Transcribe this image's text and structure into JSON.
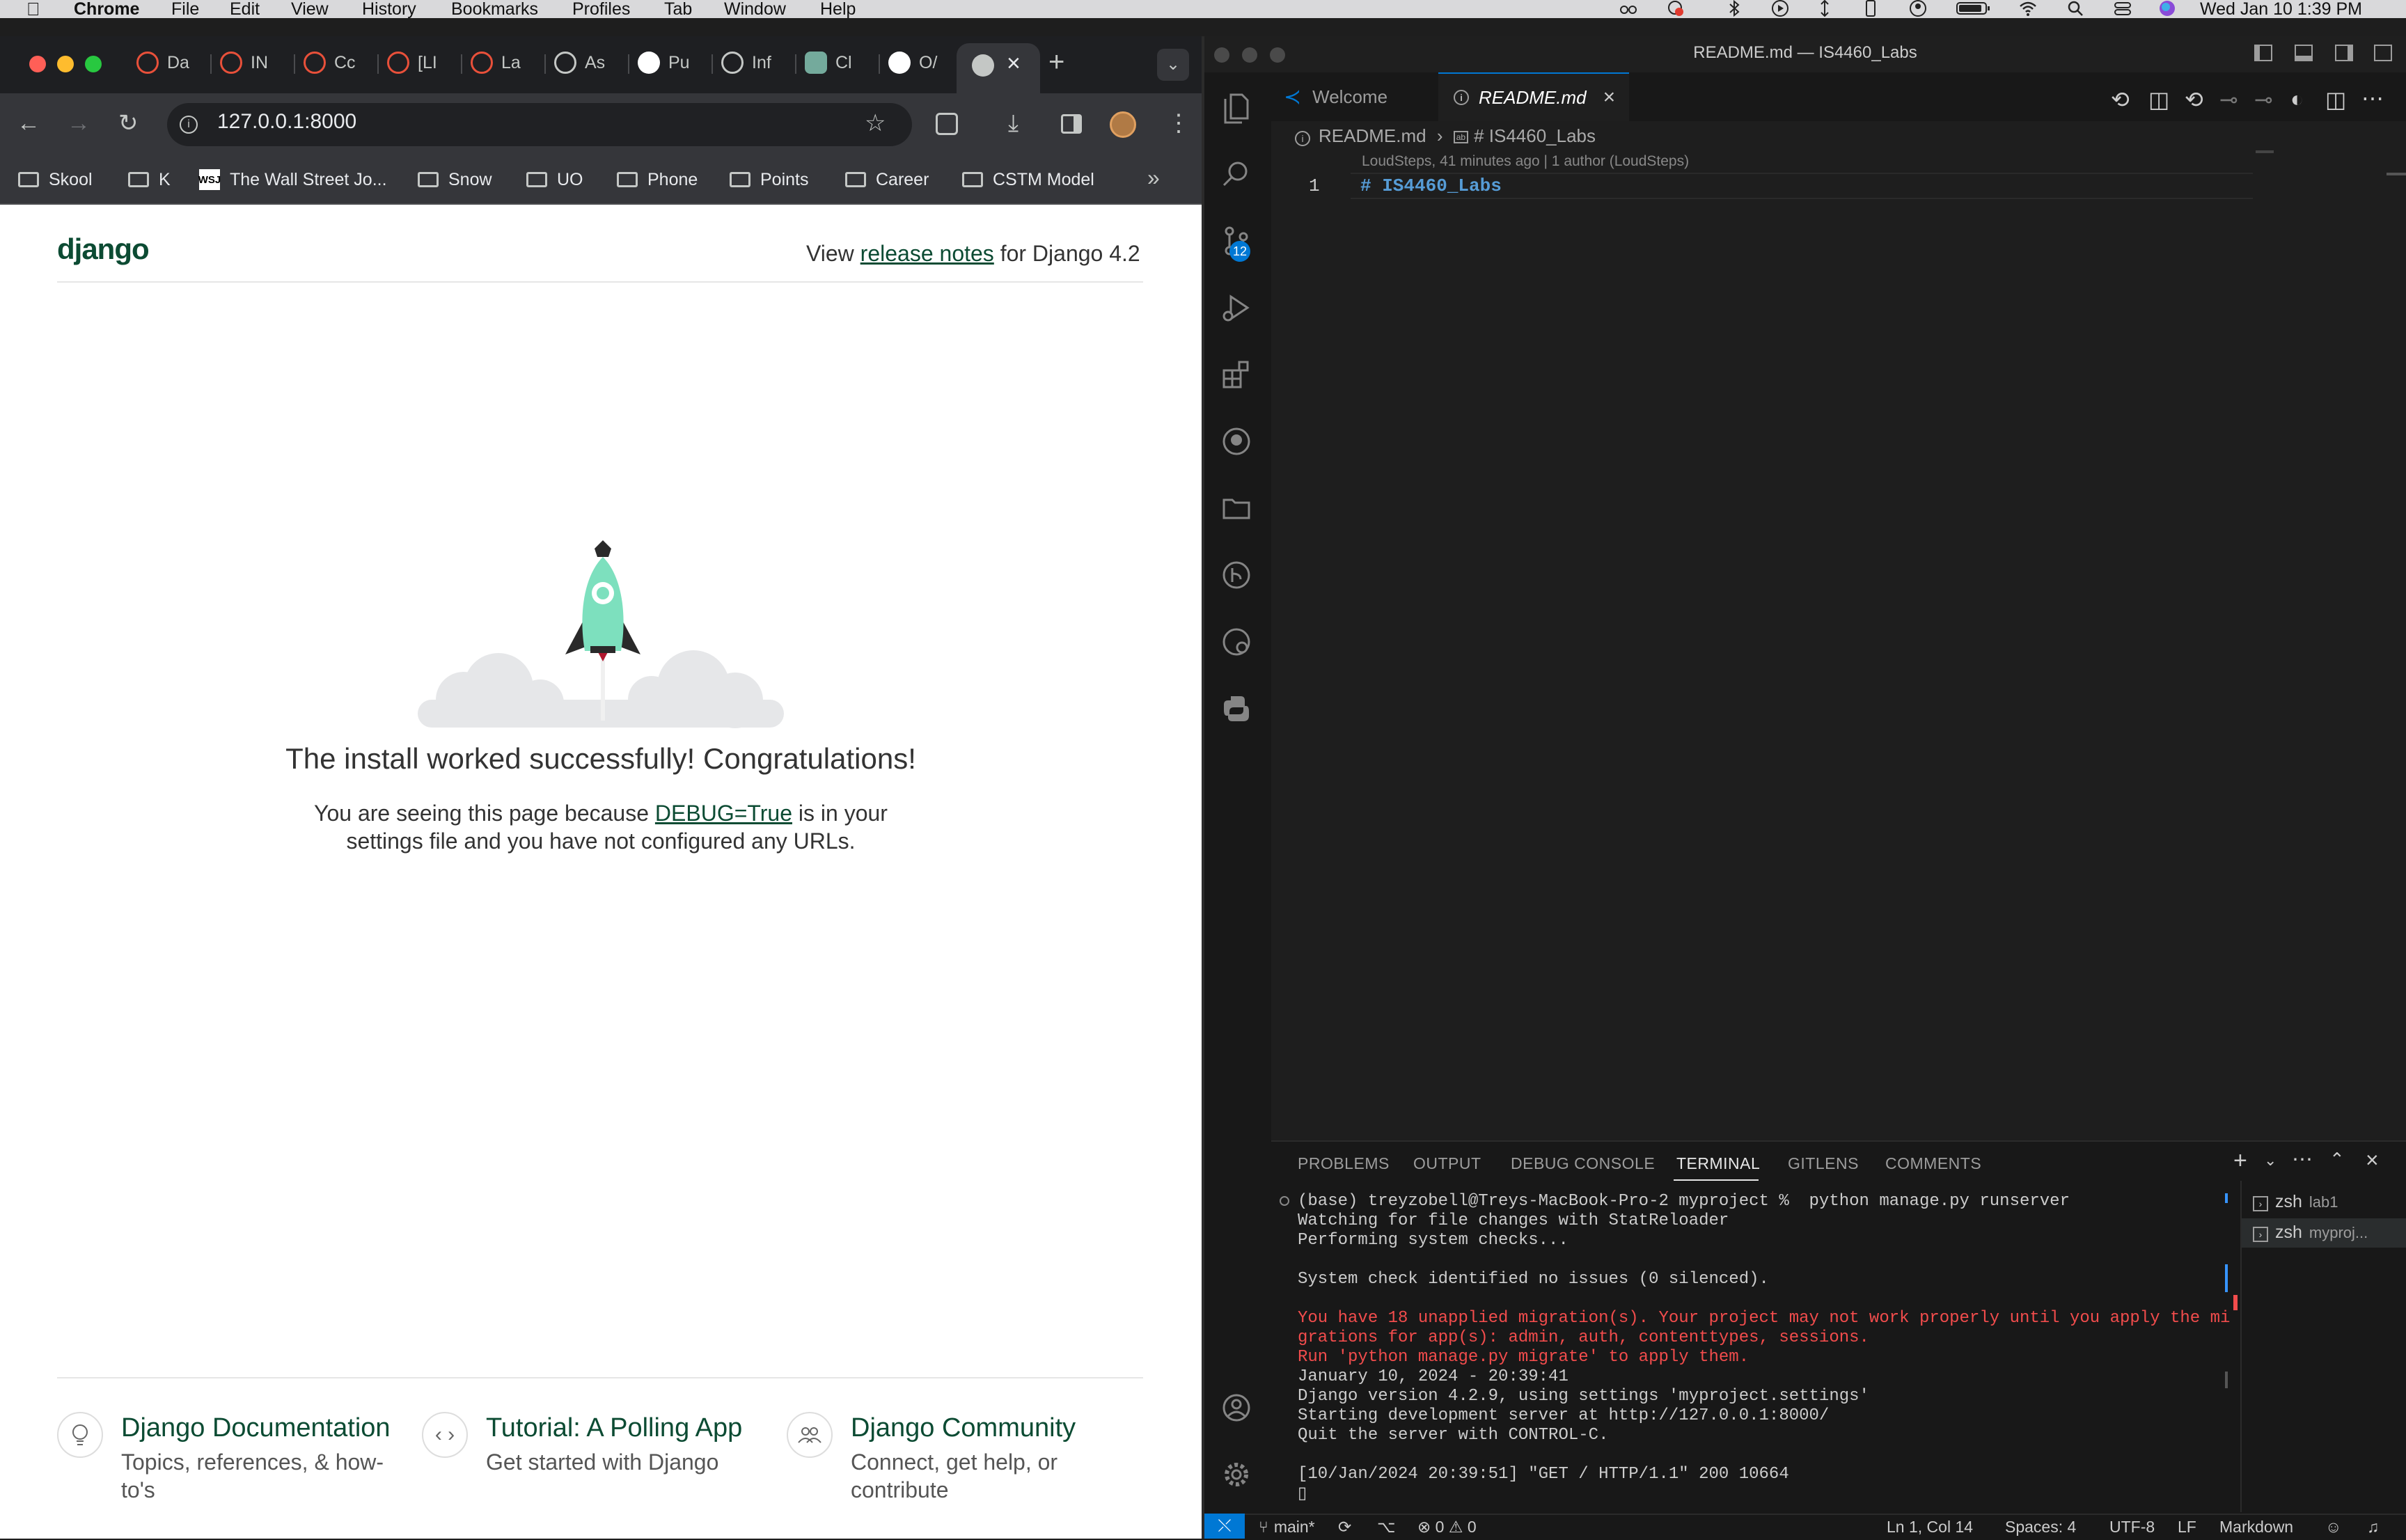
{
  "menubar": {
    "app": "Chrome",
    "items": [
      "File",
      "Edit",
      "View",
      "History",
      "Bookmarks",
      "Profiles",
      "Tab",
      "Window",
      "Help"
    ],
    "clock": "Wed Jan 10  1:39 PM"
  },
  "chrome": {
    "tabs": [
      {
        "label": "Da",
        "icon": "red-globe-icon",
        "color": "#e8503a"
      },
      {
        "label": "IN",
        "icon": "red-globe-icon",
        "color": "#e8503a"
      },
      {
        "label": "Cc",
        "icon": "red-globe-icon",
        "color": "#e8503a"
      },
      {
        "label": "[LI",
        "icon": "red-globe-icon",
        "color": "#e8503a"
      },
      {
        "label": "La",
        "icon": "red-globe-icon",
        "color": "#e8503a"
      },
      {
        "label": "As",
        "icon": "globe-icon",
        "color": "#c4c7c5"
      },
      {
        "label": "Pu",
        "icon": "github-icon",
        "color": "#ffffff"
      },
      {
        "label": "Inf",
        "icon": "globe-icon",
        "color": "#c4c7c5"
      },
      {
        "label": "Cl",
        "icon": "chatgpt-icon",
        "color": "#74aa9c"
      },
      {
        "label": "O/",
        "icon": "github-icon",
        "color": "#ffffff"
      }
    ],
    "address": "127.0.0.1:8000",
    "bookmarks": [
      {
        "label": "Skool",
        "type": "folder"
      },
      {
        "label": "K",
        "type": "folder"
      },
      {
        "label": "The Wall Street Jo...",
        "type": "wsj"
      },
      {
        "label": "Snow",
        "type": "folder"
      },
      {
        "label": "UO",
        "type": "folder"
      },
      {
        "label": "Phone",
        "type": "folder"
      },
      {
        "label": "Points",
        "type": "folder"
      },
      {
        "label": "Career",
        "type": "folder"
      },
      {
        "label": "CSTM Model",
        "type": "folder"
      }
    ]
  },
  "page": {
    "logo": "django",
    "release_prefix": "View ",
    "release_link": "release notes",
    "release_suffix": " for Django 4.2",
    "headline": "The install worked successfully! Congratulations!",
    "sub_prefix": "You are seeing this page because ",
    "sub_link": "DEBUG=True",
    "sub_suffix": " is in your",
    "sub_line2": "settings file and you have not configured any URLs.",
    "cards": [
      {
        "title": "Django Documentation",
        "desc": "Topics, references, & how-to's",
        "icon": "lightbulb-icon"
      },
      {
        "title": "Tutorial: A Polling App",
        "desc": "Get started with Django",
        "icon": "code-icon"
      },
      {
        "title": "Django Community",
        "desc": "Connect, get help, or contribute",
        "icon": "people-icon"
      }
    ],
    "accent_color": "#0c4b33",
    "rocket_color": "#7de0be"
  },
  "vscode": {
    "title": "README.md — IS4460_Labs",
    "tabs": [
      "Welcome",
      "README.md"
    ],
    "breadcrumb_file": "README.md",
    "breadcrumb_symbol": "# IS4460_Labs",
    "blame": "LoudSteps, 41 minutes ago | 1 author (LoudSteps)",
    "line_number": "1",
    "code_line": "# IS4460_Labs",
    "scm_badge": "12",
    "panel_tabs": [
      "PROBLEMS",
      "OUTPUT",
      "DEBUG CONSOLE",
      "TERMINAL",
      "GITLENS",
      "COMMENTS"
    ],
    "terminal_lines": [
      {
        "text": "(base) treyzobell@Treys-MacBook-Pro-2 myproject %  python manage.py runserver",
        "style": "normal"
      },
      {
        "text": "Watching for file changes with StatReloader",
        "style": "normal"
      },
      {
        "text": "Performing system checks...",
        "style": "normal"
      },
      {
        "text": "",
        "style": "normal"
      },
      {
        "text": "System check identified no issues (0 silenced).",
        "style": "normal"
      },
      {
        "text": "",
        "style": "normal"
      },
      {
        "text": "You have 18 unapplied migration(s). Your project may not work properly until you apply the mi",
        "style": "red"
      },
      {
        "text": "grations for app(s): admin, auth, contenttypes, sessions.",
        "style": "red"
      },
      {
        "text": "Run 'python manage.py migrate' to apply them.",
        "style": "red"
      },
      {
        "text": "January 10, 2024 - 20:39:41",
        "style": "normal"
      },
      {
        "text": "Django version 4.2.9, using settings 'myproject.settings'",
        "style": "normal"
      },
      {
        "text": "Starting development server at http://127.0.0.1:8000/",
        "style": "normal"
      },
      {
        "text": "Quit the server with CONTROL-C.",
        "style": "normal"
      },
      {
        "text": "",
        "style": "normal"
      },
      {
        "text": "[10/Jan/2024 20:39:51] \"GET / HTTP/1.1\" 200 10664",
        "style": "normal"
      },
      {
        "text": "▯",
        "style": "normal"
      }
    ],
    "terminals": [
      {
        "name": "zsh",
        "detail": "lab1"
      },
      {
        "name": "zsh",
        "detail": "myproj..."
      }
    ],
    "status": {
      "branch": "main*",
      "problems": "⊗ 0  ⚠ 0",
      "position": "Ln 1, Col 14",
      "spaces": "Spaces: 4",
      "encoding": "UTF-8",
      "eol": "LF",
      "language": "Markdown"
    }
  }
}
